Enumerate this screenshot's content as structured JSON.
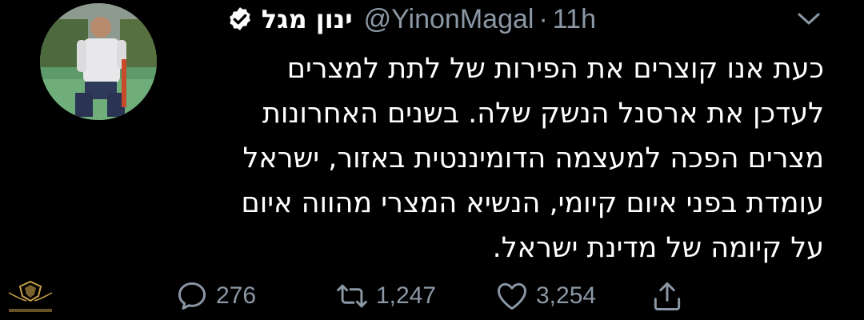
{
  "tweet": {
    "display_name": "ינון מגל",
    "handle": "@YinonMagal",
    "separator": "·",
    "time": "11h",
    "text_lines": [
      "כעת אנו קוצרים את הפירות של לתת למצרים",
      "לעדכן את ארסנל הנשק שלה. בשנים האחרונות",
      "מצרים הפכה למעצמה הדומיננטית באזור, ישראל",
      "עומדת בפני איום קיומי, הנשיא המצרי מהווה איום",
      "על קיומה של מדינת ישראל."
    ]
  },
  "actions": {
    "reply_count": "276",
    "retweet_count": "1,247",
    "like_count": "3,254"
  },
  "icons": {
    "verified": "verified-badge-icon",
    "menu": "chevron-down-icon",
    "reply": "reply-icon",
    "retweet": "retweet-icon",
    "like": "heart-icon",
    "share": "share-icon"
  },
  "colors": {
    "background": "#000000",
    "text": "#ffffff",
    "secondary": "#8b98a5"
  }
}
